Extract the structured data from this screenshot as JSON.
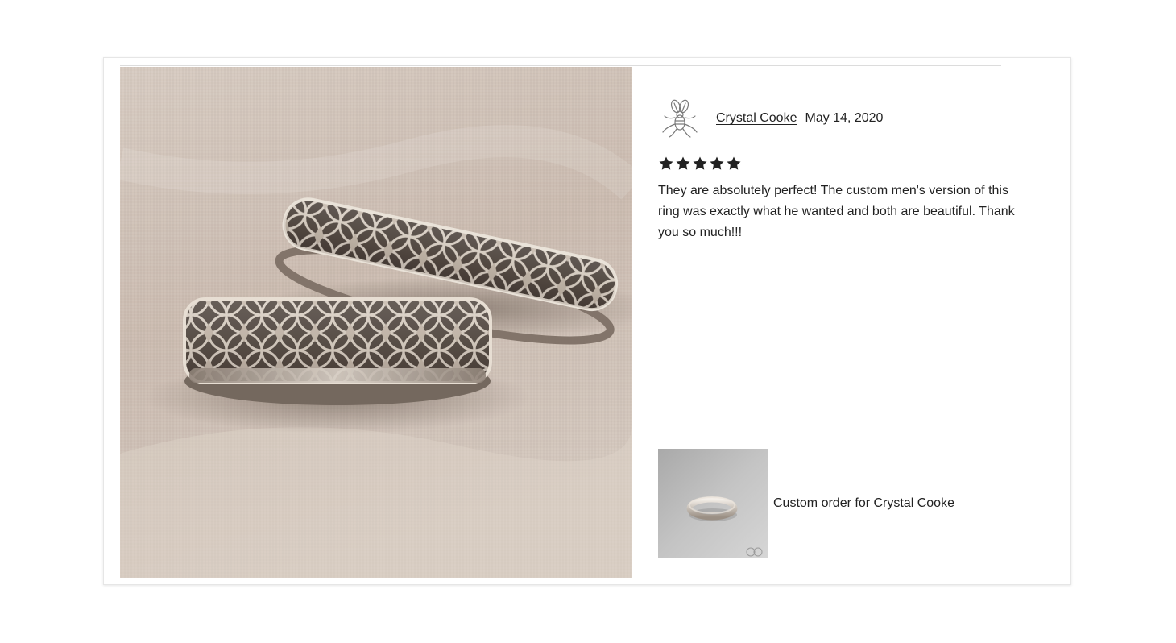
{
  "review": {
    "author": "Crystal Cooke",
    "date": "May 14, 2020",
    "rating": 5,
    "rating_max": 5,
    "text": "They are absolutely perfect! The custom men's version of this ring was exactly what he wanted and both are beautiful. Thank you so much!!!"
  },
  "item": {
    "title": "Custom order for Crystal Cooke"
  },
  "colors": {
    "text": "#222222",
    "star": "#222222",
    "card_border": "#e6e6e6",
    "photo_tint": "#cbbcb0"
  },
  "icons": {
    "avatar": "bee-drawing-avatar",
    "star": "star-icon"
  }
}
